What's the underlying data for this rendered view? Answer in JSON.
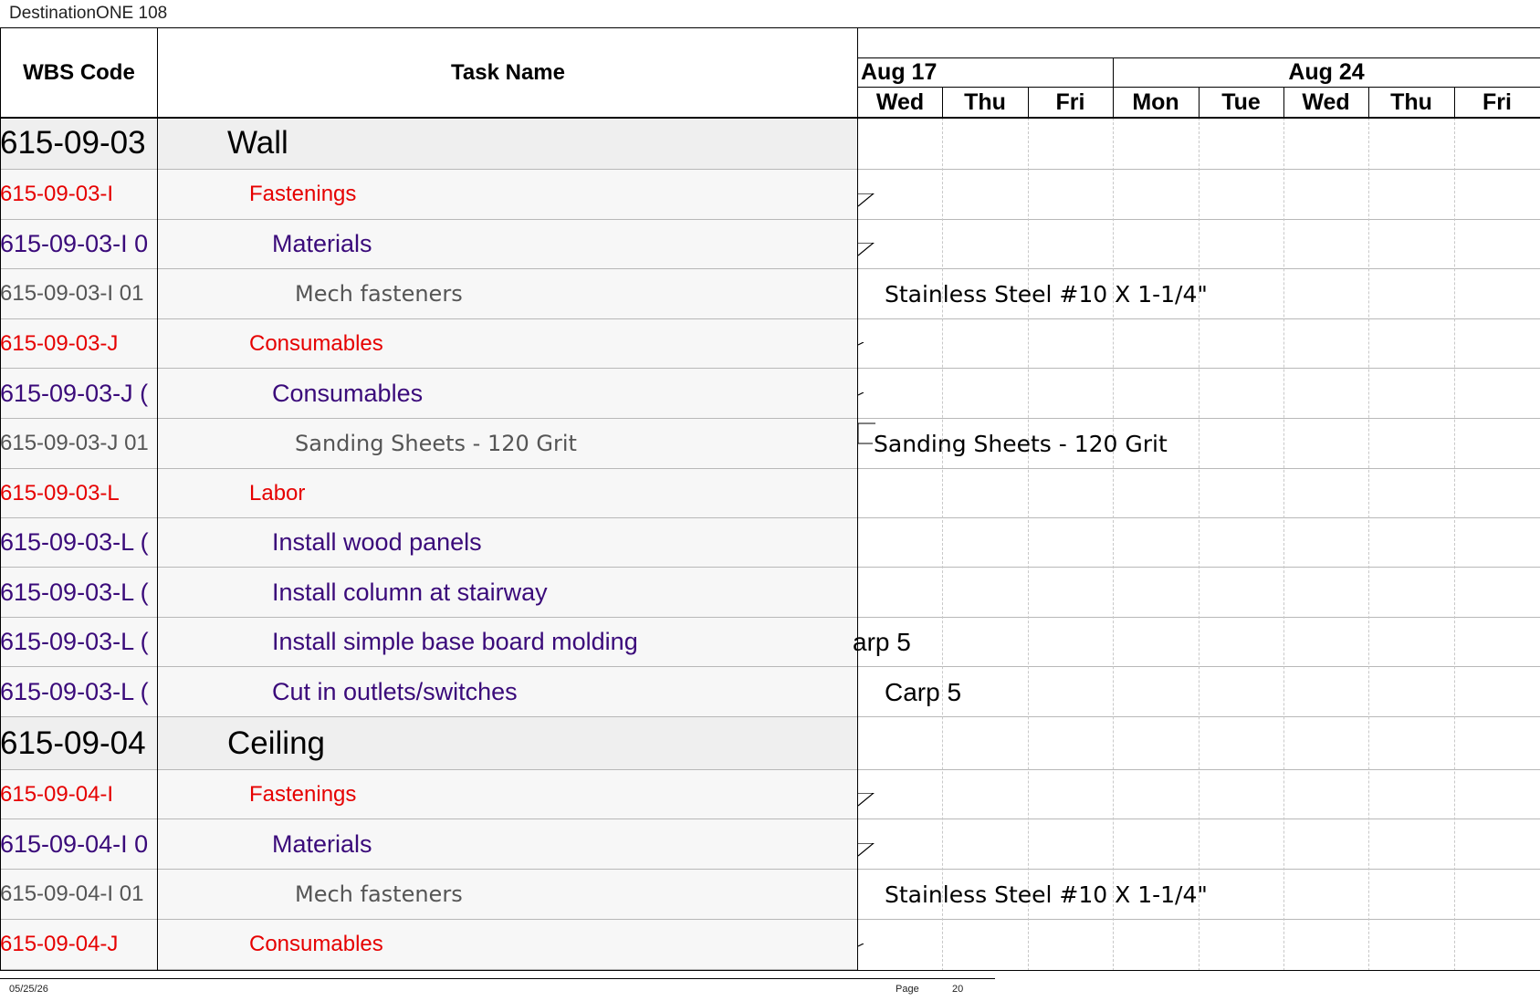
{
  "document": {
    "title": "DestinationONE 108"
  },
  "columns": {
    "wbs_code": "WBS Code",
    "task_name": "Task Name"
  },
  "timeline": {
    "months": [
      {
        "label": "Aug 17"
      },
      {
        "label": "Aug 24"
      }
    ],
    "days": [
      "Wed",
      "Thu",
      "Fri",
      "Mon",
      "Tue",
      "Wed",
      "Thu",
      "Fri"
    ]
  },
  "rows": [
    {
      "wbs": "615-09-03",
      "task": "Wall",
      "level": 0
    },
    {
      "wbs": "615-09-03-I",
      "task": "Fastenings",
      "level": 1
    },
    {
      "wbs": "615-09-03-I 0",
      "task": "Materials",
      "level": 2
    },
    {
      "wbs": "615-09-03-I 01",
      "task": "Mech fasteners",
      "level": 3
    },
    {
      "wbs": "615-09-03-J",
      "task": "Consumables",
      "level": 1
    },
    {
      "wbs": "615-09-03-J (",
      "task": "Consumables",
      "level": 2
    },
    {
      "wbs": "615-09-03-J 01",
      "task": "Sanding Sheets - 120 Grit",
      "level": 3
    },
    {
      "wbs": "615-09-03-L",
      "task": "Labor",
      "level": 1
    },
    {
      "wbs": "615-09-03-L (",
      "task": "Install wood panels",
      "level": 2
    },
    {
      "wbs": "615-09-03-L (",
      "task": "Install column at stairway",
      "level": 2
    },
    {
      "wbs": "615-09-03-L (",
      "task": "Install simple base board molding",
      "level": 2
    },
    {
      "wbs": "615-09-03-L (",
      "task": "Cut in outlets/switches",
      "level": 2
    },
    {
      "wbs": "615-09-04",
      "task": "Ceiling",
      "level": 0
    },
    {
      "wbs": "615-09-04-I",
      "task": "Fastenings",
      "level": 1
    },
    {
      "wbs": "615-09-04-I 0",
      "task": "Materials",
      "level": 2
    },
    {
      "wbs": "615-09-04-I 01",
      "task": "Mech fasteners",
      "level": 3
    },
    {
      "wbs": "615-09-04-J",
      "task": "Consumables",
      "level": 1
    }
  ],
  "bar_labels": [
    {
      "row": 3,
      "text": "Stainless Steel #10 X 1-1/4\""
    },
    {
      "row": 6,
      "text": "Sanding Sheets - 120 Grit"
    },
    {
      "row": 10,
      "text": "arp 5"
    },
    {
      "row": 11,
      "text": "Carp 5"
    },
    {
      "row": 15,
      "text": "Stainless Steel #10 X 1-1/4\""
    }
  ],
  "footer": {
    "date": "05/25/26",
    "page_label": "Page",
    "page_number": "20"
  }
}
